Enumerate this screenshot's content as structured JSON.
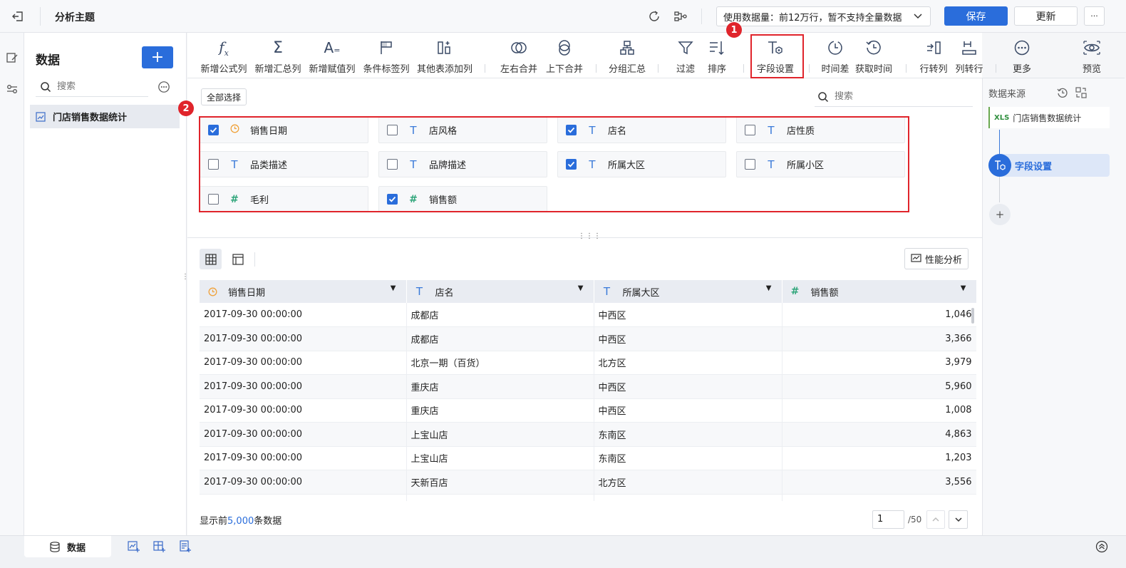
{
  "topbar": {
    "title": "分析主题",
    "data_usage": "使用数据量：前12万行，暂不支持全量数据",
    "save": "保存",
    "update": "更新",
    "more": "···"
  },
  "sidebar": {
    "heading": "数据",
    "add": "+",
    "search_placeholder": "搜索",
    "items": [
      {
        "label": "门店销售数据统计"
      }
    ]
  },
  "toolbar": {
    "items": [
      {
        "label": "新增公式列",
        "icon": "fx-icon"
      },
      {
        "label": "新增汇总列",
        "icon": "sigma-icon"
      },
      {
        "label": "新增赋值列",
        "icon": "assign-icon"
      },
      {
        "label": "条件标签列",
        "icon": "flag-icon"
      },
      {
        "label": "其他表添加列",
        "icon": "add-column-icon"
      },
      {
        "label": "左右合并",
        "icon": "merge-horizontal-icon"
      },
      {
        "label": "上下合并",
        "icon": "merge-vertical-icon"
      },
      {
        "label": "分组汇总",
        "icon": "group-icon"
      },
      {
        "label": "过滤",
        "icon": "filter-icon"
      },
      {
        "label": "排序",
        "icon": "sort-icon"
      },
      {
        "label": "字段设置",
        "icon": "field-settings-icon"
      },
      {
        "label": "时间差",
        "icon": "clock-icon"
      },
      {
        "label": "获取时间",
        "icon": "get-time-icon"
      },
      {
        "label": "行转列",
        "icon": "row-to-col-icon"
      },
      {
        "label": "列转行",
        "icon": "col-to-row-icon"
      },
      {
        "label": "更多",
        "icon": "more-icon"
      },
      {
        "label": "预览",
        "icon": "preview-icon"
      }
    ]
  },
  "fields_panel": {
    "select_all": "全部选择",
    "search_placeholder": "搜索",
    "fields": [
      {
        "name": "销售日期",
        "type": "date",
        "checked": true
      },
      {
        "name": "店风格",
        "type": "text",
        "checked": false
      },
      {
        "name": "店名",
        "type": "text",
        "checked": true
      },
      {
        "name": "店性质",
        "type": "text",
        "checked": false
      },
      {
        "name": "品类描述",
        "type": "text",
        "checked": false
      },
      {
        "name": "品牌描述",
        "type": "text",
        "checked": false
      },
      {
        "name": "所属大区",
        "type": "text",
        "checked": true
      },
      {
        "name": "所属小区",
        "type": "text",
        "checked": false
      },
      {
        "name": "毛利",
        "type": "number",
        "checked": false
      },
      {
        "name": "销售额",
        "type": "number",
        "checked": true
      }
    ]
  },
  "badges": {
    "one": "1",
    "two": "2"
  },
  "preview": {
    "perf_button": "性能分析",
    "columns": [
      {
        "name": "销售日期",
        "type": "date"
      },
      {
        "name": "店名",
        "type": "text"
      },
      {
        "name": "所属大区",
        "type": "text"
      },
      {
        "name": "销售额",
        "type": "number"
      }
    ],
    "rows": [
      [
        "2017-09-30 00:00:00",
        "成都店",
        "中西区",
        "1,046"
      ],
      [
        "2017-09-30 00:00:00",
        "成都店",
        "中西区",
        "3,366"
      ],
      [
        "2017-09-30 00:00:00",
        "北京一期（百货）",
        "北方区",
        "3,979"
      ],
      [
        "2017-09-30 00:00:00",
        "重庆店",
        "中西区",
        "5,960"
      ],
      [
        "2017-09-30 00:00:00",
        "重庆店",
        "中西区",
        "1,008"
      ],
      [
        "2017-09-30 00:00:00",
        "上宝山店",
        "东南区",
        "4,863"
      ],
      [
        "2017-09-30 00:00:00",
        "上宝山店",
        "东南区",
        "1,203"
      ],
      [
        "2017-09-30 00:00:00",
        "天新百店",
        "北方区",
        "3,556"
      ]
    ],
    "footer_prefix": "显示前",
    "footer_count": "5,000",
    "footer_suffix": "条数据",
    "page_value": "1",
    "page_total": "/50"
  },
  "right_panel": {
    "title": "数据来源",
    "source_badge": "XLS",
    "source": "门店销售数据统计",
    "step": "字段设置",
    "add": "+"
  },
  "bottom": {
    "tab": "数据"
  },
  "colors": {
    "accent": "#2a6ddb",
    "highlight": "#e0242b",
    "date_icon": "#f0a23b",
    "field_icon": "#3a7ad9",
    "number_icon": "#2fa57a"
  }
}
